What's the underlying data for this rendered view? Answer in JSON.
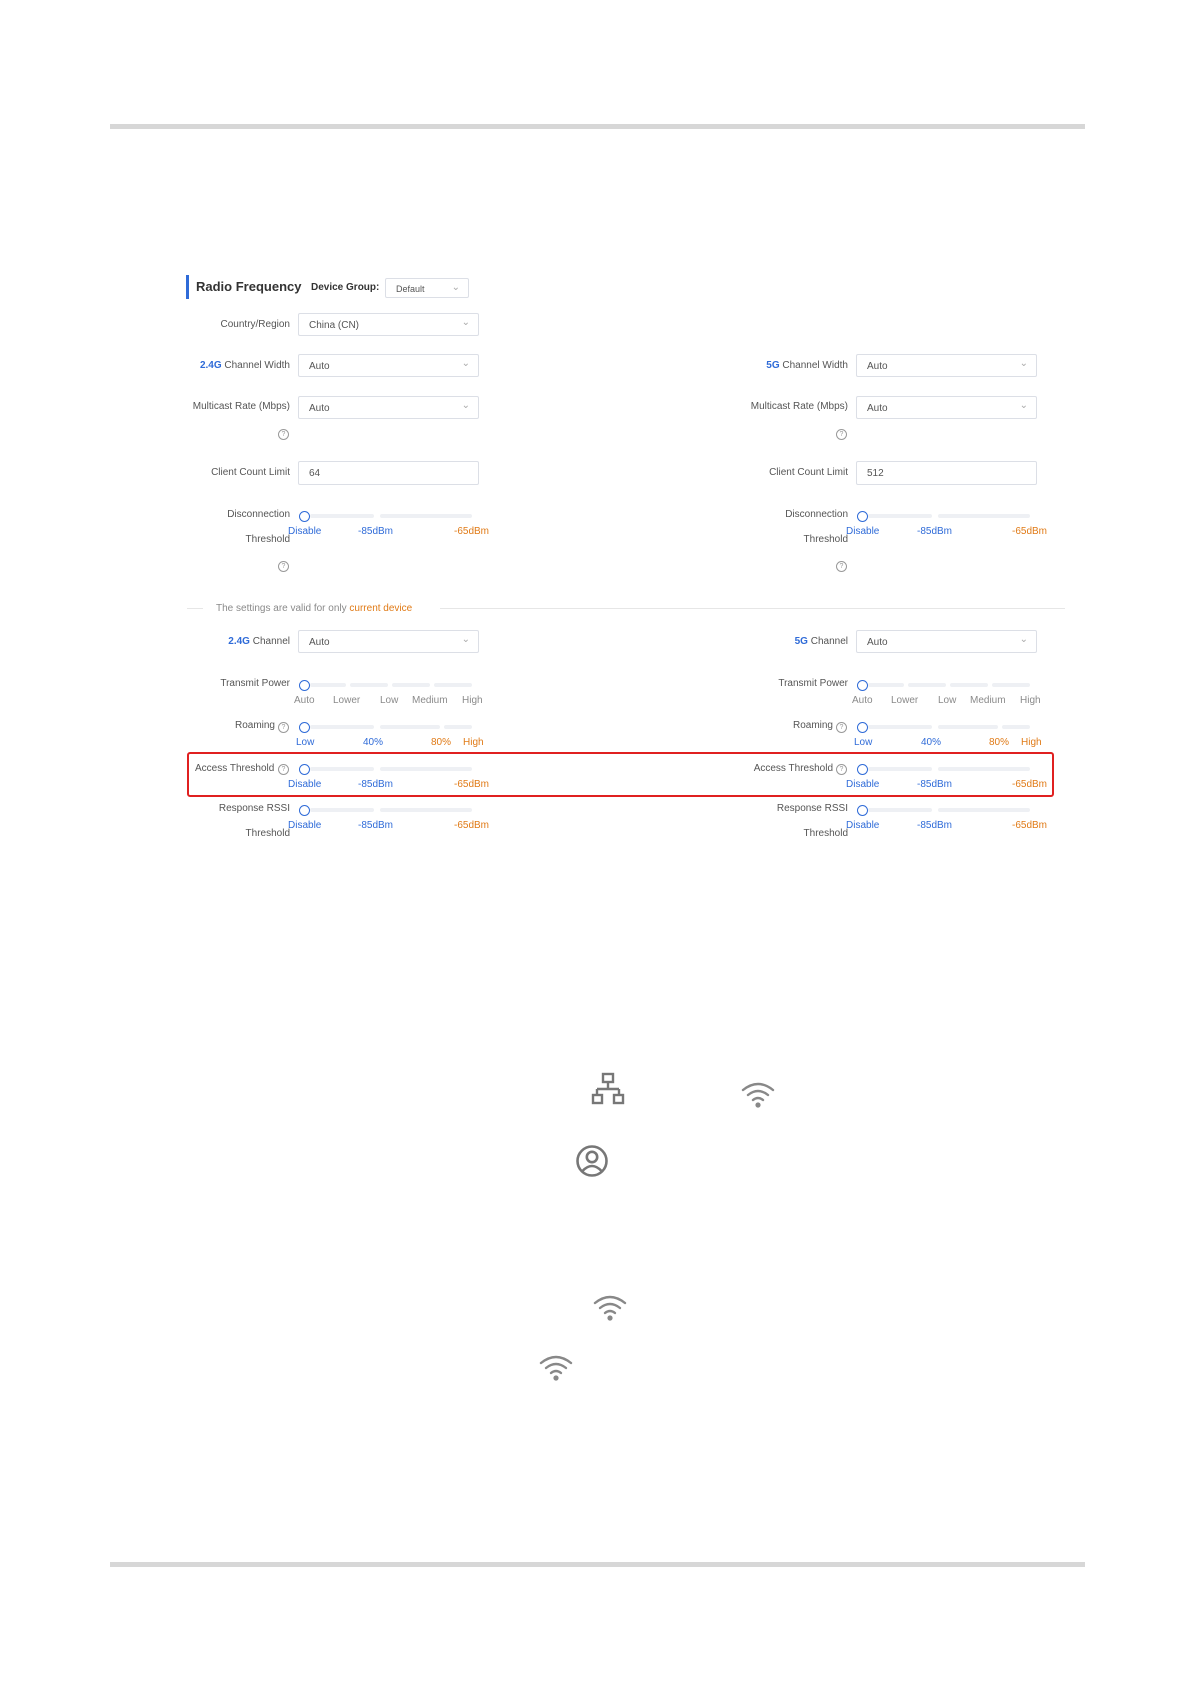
{
  "header": {
    "title": "Radio Frequency",
    "device_group_label": "Device Group:",
    "device_group_value": "Default"
  },
  "country": {
    "label": "Country/Region",
    "value": "China (CN)"
  },
  "left": {
    "channel_width": {
      "label_prefix": "2.4G",
      "label_rest": " Channel Width",
      "value": "Auto"
    },
    "multicast": {
      "label": "Multicast Rate (Mbps)",
      "value": "Auto"
    },
    "client_limit": {
      "label": "Client Count Limit",
      "value": "64"
    },
    "disconnection": {
      "label_line1": "Disconnection",
      "label_line2": "Threshold",
      "ticks": [
        "Disable",
        "-85dBm",
        "-65dBm"
      ]
    },
    "channel": {
      "label_prefix": "2.4G",
      "label_rest": " Channel",
      "value": "Auto"
    },
    "transmit_power": {
      "label": "Transmit Power",
      "ticks": [
        "Auto",
        "Lower",
        "Low",
        "Medium",
        "High"
      ]
    },
    "roaming": {
      "label": "Roaming",
      "ticks": [
        "Low",
        "40%",
        "80%",
        "High"
      ]
    },
    "access_threshold": {
      "label": "Access Threshold",
      "ticks": [
        "Disable",
        "-85dBm",
        "-65dBm"
      ]
    },
    "response_rssi": {
      "label_line1": "Response RSSI",
      "label_line2": "Threshold",
      "ticks": [
        "Disable",
        "-85dBm",
        "-65dBm"
      ]
    }
  },
  "right": {
    "channel_width": {
      "label_prefix": "5G",
      "label_rest": " Channel Width",
      "value": "Auto"
    },
    "multicast": {
      "label": "Multicast Rate (Mbps)",
      "value": "Auto"
    },
    "client_limit": {
      "label": "Client Count Limit",
      "value": "512"
    },
    "disconnection": {
      "label_line1": "Disconnection",
      "label_line2": "Threshold",
      "ticks": [
        "Disable",
        "-85dBm",
        "-65dBm"
      ]
    },
    "channel": {
      "label_prefix": "5G",
      "label_rest": " Channel",
      "value": "Auto"
    },
    "transmit_power": {
      "label": "Transmit Power",
      "ticks": [
        "Auto",
        "Lower",
        "Low",
        "Medium",
        "High"
      ]
    },
    "roaming": {
      "label": "Roaming",
      "ticks": [
        "Low",
        "40%",
        "80%",
        "High"
      ]
    },
    "access_threshold": {
      "label": "Access Threshold",
      "ticks": [
        "Disable",
        "-85dBm",
        "-65dBm"
      ]
    },
    "response_rssi": {
      "label_line1": "Response RSSI",
      "label_line2": "Threshold",
      "ticks": [
        "Disable",
        "-85dBm",
        "-65dBm"
      ]
    }
  },
  "note": {
    "text": "The settings are valid for only ",
    "highlight": "current device"
  },
  "help_glyph": "?",
  "chevron_glyph": "⌄",
  "icons": [
    "network-topology-icon",
    "wifi-icon",
    "user-circle-icon",
    "wifi-icon",
    "wifi-icon"
  ],
  "colors": {
    "accent": "#2f6bd8",
    "orange": "#e07a16",
    "highlight_border": "#e02020"
  }
}
